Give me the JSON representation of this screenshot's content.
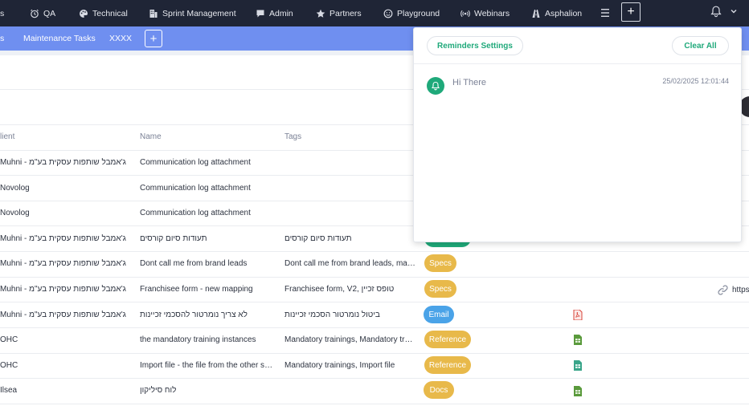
{
  "nav": {
    "items": [
      {
        "label": "s",
        "icon": ""
      },
      {
        "label": "QA",
        "icon": "alarm-icon"
      },
      {
        "label": "Technical",
        "icon": "palette-icon"
      },
      {
        "label": "Sprint Management",
        "icon": "building-icon"
      },
      {
        "label": "Admin",
        "icon": "chat-bubble-icon"
      },
      {
        "label": "Partners",
        "icon": "star-icon"
      },
      {
        "label": "Playground",
        "icon": "smiley-icon"
      },
      {
        "label": "Webinars",
        "icon": "broadcast-icon"
      },
      {
        "label": "Asphalion",
        "icon": "road-icon"
      }
    ],
    "plus_label": "+"
  },
  "tabs": {
    "items": [
      {
        "label": "s"
      },
      {
        "label": "Maintenance Tasks"
      },
      {
        "label": "XXXX"
      }
    ],
    "add_label": "+"
  },
  "table": {
    "headers": {
      "client": "lient",
      "name": "Name",
      "tags": "Tags"
    },
    "rows": [
      {
        "client": "Muhni - ג'אמבל שותפות עסקית בע\"מ",
        "name": "Communication log attachment",
        "tags": "",
        "category": "",
        "file": ""
      },
      {
        "client": "Novolog",
        "name": "Communication log attachment",
        "tags": "",
        "category": "",
        "file": ""
      },
      {
        "client": "Novolog",
        "name": "Communication log attachment",
        "tags": "",
        "category": "",
        "file": ""
      },
      {
        "client": "Muhni - ג'אמבל שותפות עסקית בע\"מ",
        "name": "תעודות סיום קורסים",
        "tags": "תעודות סיום קורסים",
        "category": "",
        "file": ""
      },
      {
        "client": "Muhni - ג'אמבל שותפות עסקית בע\"מ",
        "name": "Dont call me from brand leads",
        "tags": "Dont call me from brand leads, mappi...",
        "category": "Specs",
        "file": ""
      },
      {
        "client": "Muhni - ג'אמבל שותפות עסקית בע\"מ",
        "name": "Franchisee form - new mapping",
        "tags": "Franchisee form, V2, טופס זכיין",
        "category": "Specs",
        "file": ""
      },
      {
        "client": "Muhni - ג'אמבל שותפות עסקית בע\"מ",
        "name": "לא צריך נומרטור להסכמי זכיינות",
        "tags": "ביטול נומרטור הסכמי זכיינות",
        "category": "Email",
        "file": "pdf-file-icon"
      },
      {
        "client": "OHC",
        "name": "the mandatory training instances",
        "tags": "Mandatory trainings, Mandatory traini...",
        "category": "Reference",
        "file": "spreadsheet-file-icon"
      },
      {
        "client": "OHC",
        "name": "Import file - the file from the other sys...",
        "tags": "Mandatory trainings, Import file",
        "category": "Reference",
        "file": "spreadsheet-file-icon"
      },
      {
        "client": "Ilsea",
        "name": "לוח סיליקון",
        "tags": "",
        "category": "Docs",
        "file": "spreadsheet-file-icon"
      }
    ],
    "link_text": "https"
  },
  "colors": {
    "nav_bg": "#1f2536",
    "tabbar_bg": "#6f8ff0",
    "accent_green": "#1fa97a",
    "pill_yellow": "#e8b94a",
    "pill_blue": "#4aa3e8"
  },
  "reminders": {
    "settings_label": "Reminders Settings",
    "clear_all_label": "Clear All",
    "items": [
      {
        "title": "Hi There",
        "time": "25/02/2025 12:01:44",
        "icon": "bell-icon"
      }
    ]
  }
}
